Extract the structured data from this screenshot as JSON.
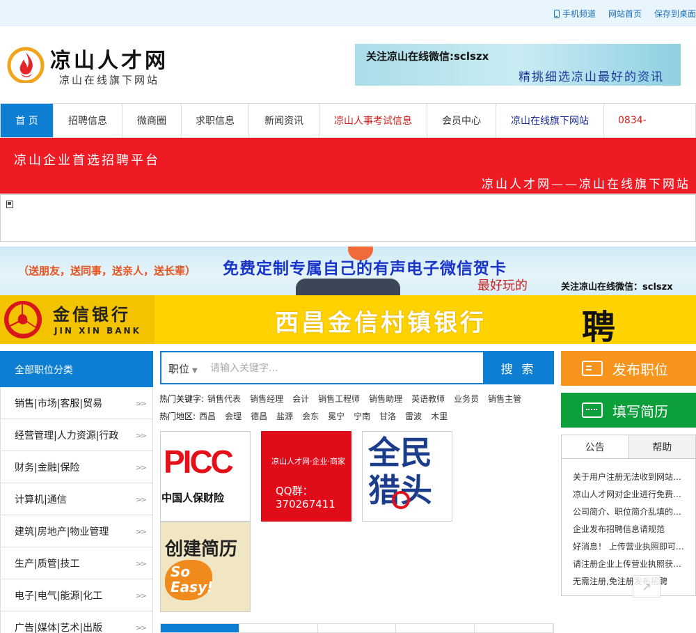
{
  "topbar": {
    "links": [
      "手机频道",
      "网站首页",
      "保存到桌面"
    ]
  },
  "header": {
    "logo_title": "凉山人才网",
    "logo_subtitle": "凉山在线旗下网站",
    "wechat_line1": "关注凉山在线微信:sclszx",
    "wechat_line2": "精挑细选凉山最好的资讯"
  },
  "nav": [
    {
      "label": "首 页",
      "width": 76
    },
    {
      "label": "招聘信息",
      "width": 99
    },
    {
      "label": "微商圈",
      "width": 85
    },
    {
      "label": "求职信息",
      "width": 97
    },
    {
      "label": "新闻资讯",
      "width": 101
    },
    {
      "label": "凉山人事考试信息",
      "width": 155
    },
    {
      "label": "会员中心",
      "width": 99
    },
    {
      "label": "凉山在线旗下网站",
      "width": 155
    },
    {
      "label": "0834-",
      "width": 131
    }
  ],
  "red_banner": {
    "line1": "凉山企业首选招聘平台",
    "line2": "凉山人才网——凉山在线旗下网站"
  },
  "card_banner": {
    "left": "（送朋友，送同事，送亲人，送长辈）",
    "title": "免费定制专属自己的有声电子微信贺卡",
    "fun": "最好玩的",
    "wechat": "关注凉山在线微信：sclszx"
  },
  "bank_banner": {
    "name_cn": "金信银行",
    "name_en": "JIN XIN BANK",
    "title": "西昌金信村镇银行",
    "hire": "聘"
  },
  "categories": {
    "header": "全部职位分类",
    "items": [
      "销售|市场|客服|贸易",
      "经营管理|人力资源|行政",
      "财务|金融|保险",
      "计算机|通信",
      "建筑|房地产|物业管理",
      "生产|质管|技工",
      "电子|电气|能源|化工",
      "广告|媒体|艺术|出版"
    ]
  },
  "search": {
    "select": "职位",
    "placeholder": "请输入关键字...",
    "button": "搜 索"
  },
  "hot_keywords": {
    "label": "热门关键字:",
    "items": [
      "销售代表",
      "销售经理",
      "会计",
      "销售工程师",
      "销售助理",
      "英语教师",
      "业务员",
      "销售主管"
    ]
  },
  "hot_areas": {
    "label": "热门地区:",
    "items": [
      "西昌",
      "会理",
      "德昌",
      "盐源",
      "会东",
      "冕宁",
      "宁南",
      "甘洛",
      "雷波",
      "木里"
    ]
  },
  "tiles": {
    "picc_big": "PICC",
    "picc_small": "中国人保财险",
    "qq_line1": "凉山人才网·企业·商家",
    "qq_line2": "QQ群：370267411",
    "qm_line1": "全民",
    "qm_line2": "猎头",
    "cv_title": "创建简历",
    "cv_so": "So",
    "cv_easy": "Easy!"
  },
  "right": {
    "post_job": "发布职位",
    "fill_resume": "填写简历",
    "tabs": [
      "公告",
      "帮助"
    ],
    "notices": [
      "关于用户注册无法收到网站验证码的说明",
      "凉山人才网对企业进行免费认证",
      "公司简介、职位简介乱填的处理",
      "企业发布招聘信息请规范",
      "好消息！ 上传营业执照即可免费发布",
      "请注册企业上传营业执照获取认证",
      "无需注册,免注册发布招聘"
    ]
  },
  "colors": {
    "primary": "#0d7ed1",
    "red": "#ee1b24",
    "orange": "#f7941d",
    "green": "#0c9f3a",
    "bank_yellow": "#ffd200"
  }
}
